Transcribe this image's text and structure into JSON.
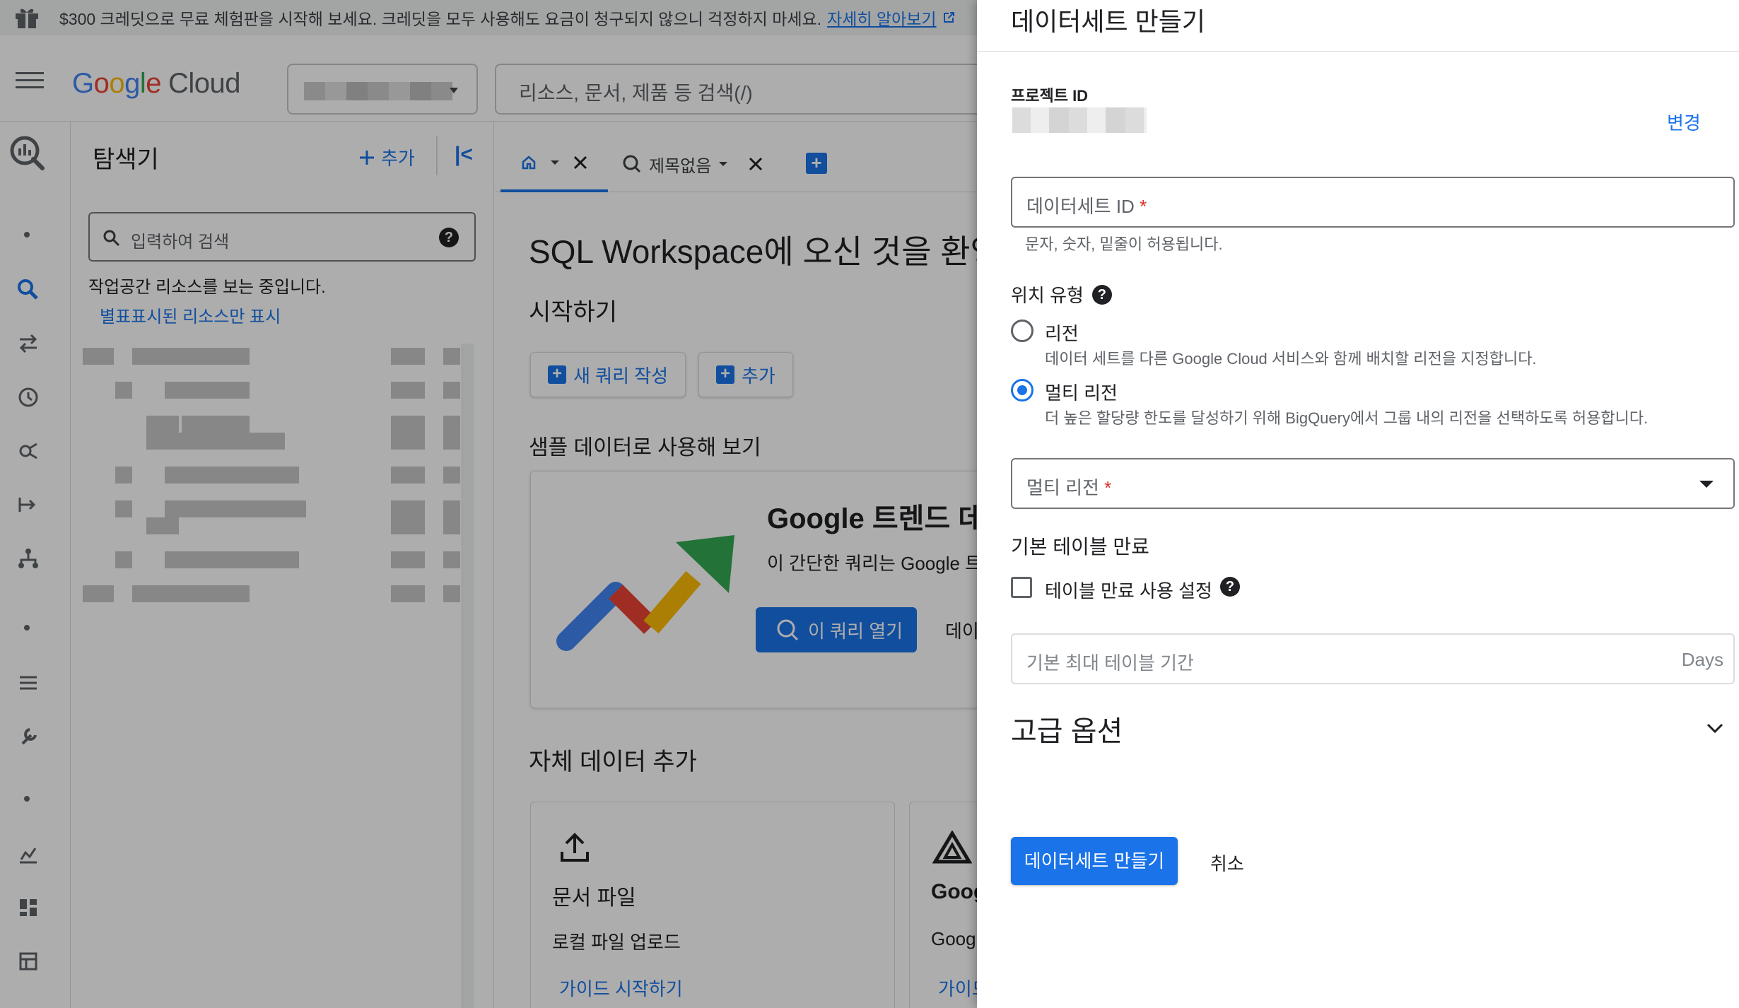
{
  "banner": {
    "text": "$300 크레딧으로 무료 체험판을 시작해 보세요. 크레딧을 모두 사용해도 요금이 청구되지 않으니 걱정하지 마세요.",
    "link": "자세히 알아보기"
  },
  "header": {
    "logo_google": [
      "G",
      "o",
      "o",
      "g",
      "l",
      "e"
    ],
    "logo_cloud": "Cloud",
    "search_placeholder": "리소스, 문서, 제품 등 검색(/)"
  },
  "explorer": {
    "title": "탐색기",
    "add_label": "추가",
    "search_placeholder": "입력하여 검색",
    "note": "작업공간 리소스를 보는 중입니다.",
    "starred_link": "별표표시된 리소스만 표시"
  },
  "tabs": {
    "untitled": "제목없음"
  },
  "workspace": {
    "title": "SQL Workspace에 오신 것을 환영",
    "start": "시작하기",
    "new_query": "새 쿼리 작성",
    "add": "추가",
    "sample_heading": "샘플 데이터로 사용해 보기",
    "trend_title": "Google 트렌드 데모",
    "trend_desc": "이 간단한 쿼리는 Google 트렌",
    "trend_open": "이 쿼리 열기",
    "trend_more": "데이",
    "own_heading": "자체 데이터 추가",
    "card1_title": "문서 파일",
    "card1_sub": "로컬 파일 업로드",
    "card1_link": "가이드 시작하기",
    "card2_title": "Goog",
    "card2_sub": "Goog",
    "card2_link": "가이드"
  },
  "panel": {
    "title": "데이터세트 만들기",
    "project_id_label": "프로젝트 ID",
    "change": "변경",
    "dataset_id_label": "데이터세트 ID",
    "required_mark": "*",
    "dataset_id_hint": "문자, 숫자, 밑줄이 허용됩니다.",
    "location_type_label": "위치 유형",
    "region_label": "리전",
    "region_desc": "데이터 세트를 다른 Google Cloud 서비스와 함께 배치할 리전을 지정합니다.",
    "multi_region_label": "멀티 리전",
    "multi_region_desc": "더 높은 할당량 한도를 달성하기 위해 BigQuery에서 그룹 내의 리전을 선택하도록 허용합니다.",
    "location_type_selected": "멀티 리전",
    "multi_region_select_label": "멀티 리전",
    "table_expiry_heading": "기본 테이블 만료",
    "table_expiry_checkbox": "테이블 만료 사용 설정",
    "table_expiry_checked": false,
    "max_age_placeholder": "기본 최대 테이블 기간",
    "max_age_unit": "Days",
    "advanced_options": "고급 옵션",
    "create_button": "데이터세트 만들기",
    "cancel_button": "취소"
  },
  "colors": {
    "accent": "#1a73e8",
    "required": "#d93025",
    "scrim": "rgba(0,0,0,0.32)"
  }
}
